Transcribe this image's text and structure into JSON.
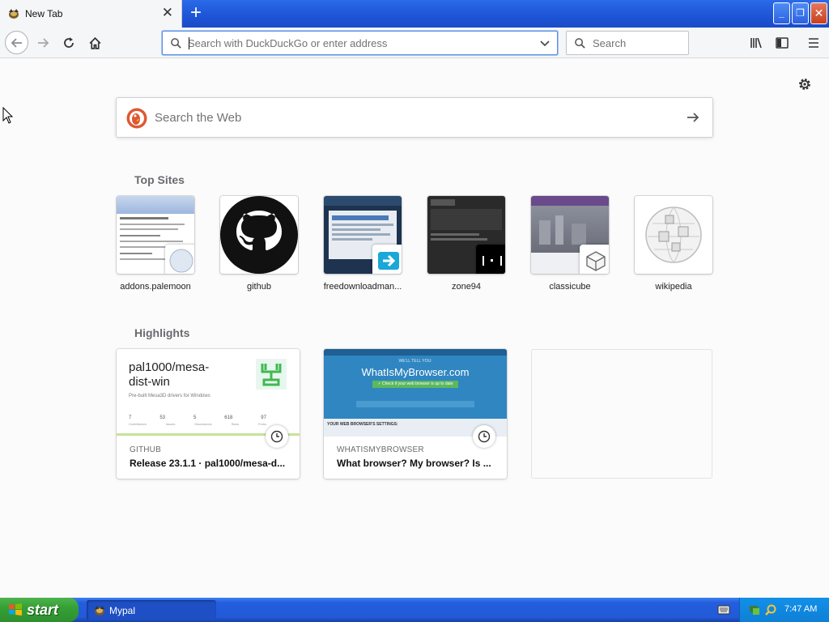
{
  "tab": {
    "title": "New Tab",
    "close": "✕"
  },
  "newtab": "+",
  "window": {
    "min": "_",
    "max": "❐",
    "close": "✕"
  },
  "urlbar": {
    "placeholder": "Search with DuckDuckGo or enter address"
  },
  "searchbar": {
    "placeholder": "Search"
  },
  "websearch": {
    "placeholder": "Search the Web"
  },
  "top_sites": {
    "title": "Top Sites",
    "items": [
      {
        "label": "addons.palemoon"
      },
      {
        "label": "github"
      },
      {
        "label": "freedownloadman..."
      },
      {
        "label": "zone94"
      },
      {
        "label": "classicube"
      },
      {
        "label": "wikipedia"
      }
    ]
  },
  "highlights": {
    "title": "Highlights",
    "cards": [
      {
        "source": "GITHUB",
        "title": "Release 23.1.1 · pal1000/mesa-d...",
        "preview_heading": "pal1000/mesa-dist-win",
        "preview_sub": "Pre-built Mesa3D drivers for Windows",
        "preview_stats": [
          "7",
          "53",
          "5",
          "618",
          "97"
        ],
        "preview_stat_labels": [
          "Contributors",
          "Issues",
          "Discussions",
          "Stars",
          "Forks"
        ]
      },
      {
        "source": "WHATISMYBROWSER",
        "title": "What browser? My browser? Is ...",
        "preview_brand": "WhatIsMyBrowser.com",
        "preview_tagline": "WE'LL TELL YOU:",
        "preview_check": "✓ Check if your web browser is up to date",
        "preview_footer": "YOUR WEB BROWSER'S SETTINGS:"
      }
    ]
  },
  "taskbar": {
    "start": "start",
    "task": "Mypal",
    "time": "7:47 AM"
  },
  "colors": {
    "accent": "#0a84ff",
    "taskbar": "#245edc",
    "start": "#35a135",
    "github_green": "#3fb950",
    "wimb_blue": "#2f86c1"
  }
}
